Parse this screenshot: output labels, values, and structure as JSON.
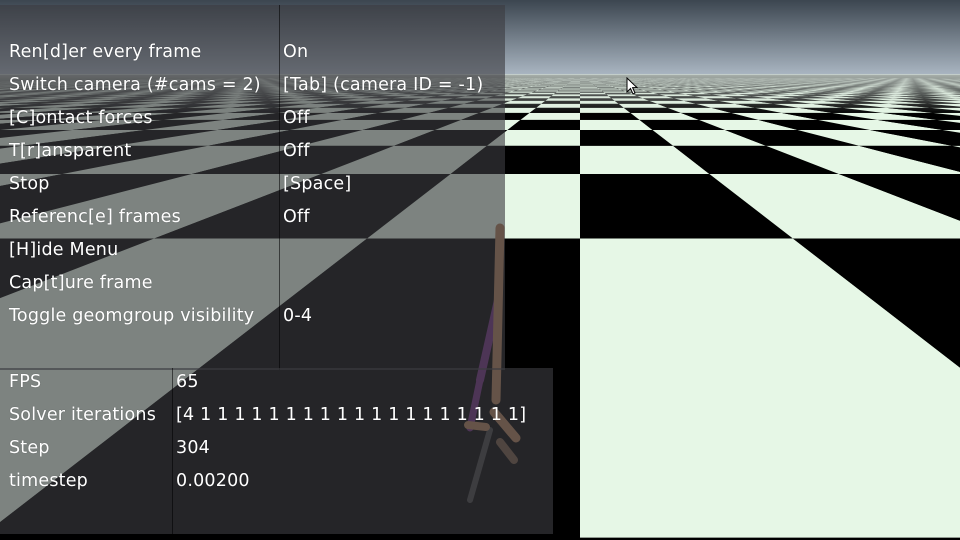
{
  "menu": {
    "rows": [
      {
        "key": "Ren[d]er every frame",
        "value": "On"
      },
      {
        "key": "Switch camera (#cams = 2)",
        "value": "[Tab] (camera ID = -1)"
      },
      {
        "key": "[C]ontact forces",
        "value": "Off"
      },
      {
        "key": "T[r]ansparent",
        "value": "Off"
      },
      {
        "key": "Stop",
        "value": "[Space]"
      },
      {
        "key": "Referenc[e] frames",
        "value": "Off"
      },
      {
        "key": "[H]ide Menu",
        "value": ""
      },
      {
        "key": "Cap[t]ure frame",
        "value": ""
      },
      {
        "key": "Toggle geomgroup visibility",
        "value": "0-4"
      }
    ]
  },
  "info": {
    "rows": [
      {
        "key": "FPS",
        "value": "65"
      },
      {
        "key": "Solver iterations",
        "value": "[4 1 1 1 1 1 1 1 1 1 1 1 1 1 1 1 1 1 1 1]"
      },
      {
        "key": "Step",
        "value": "304"
      },
      {
        "key": "timestep",
        "value": "0.00200"
      }
    ]
  },
  "colors": {
    "sky_top": "#3c4650",
    "sky_bottom": "#aab6c2",
    "tile_light": "#e6f7e6",
    "tile_dark": "#000000",
    "overlay": "#3c3c40",
    "robot_body": "#a87a55",
    "robot_leg": "#6a2a7a"
  },
  "icons": {
    "cursor": "mouse-pointer-icon"
  }
}
